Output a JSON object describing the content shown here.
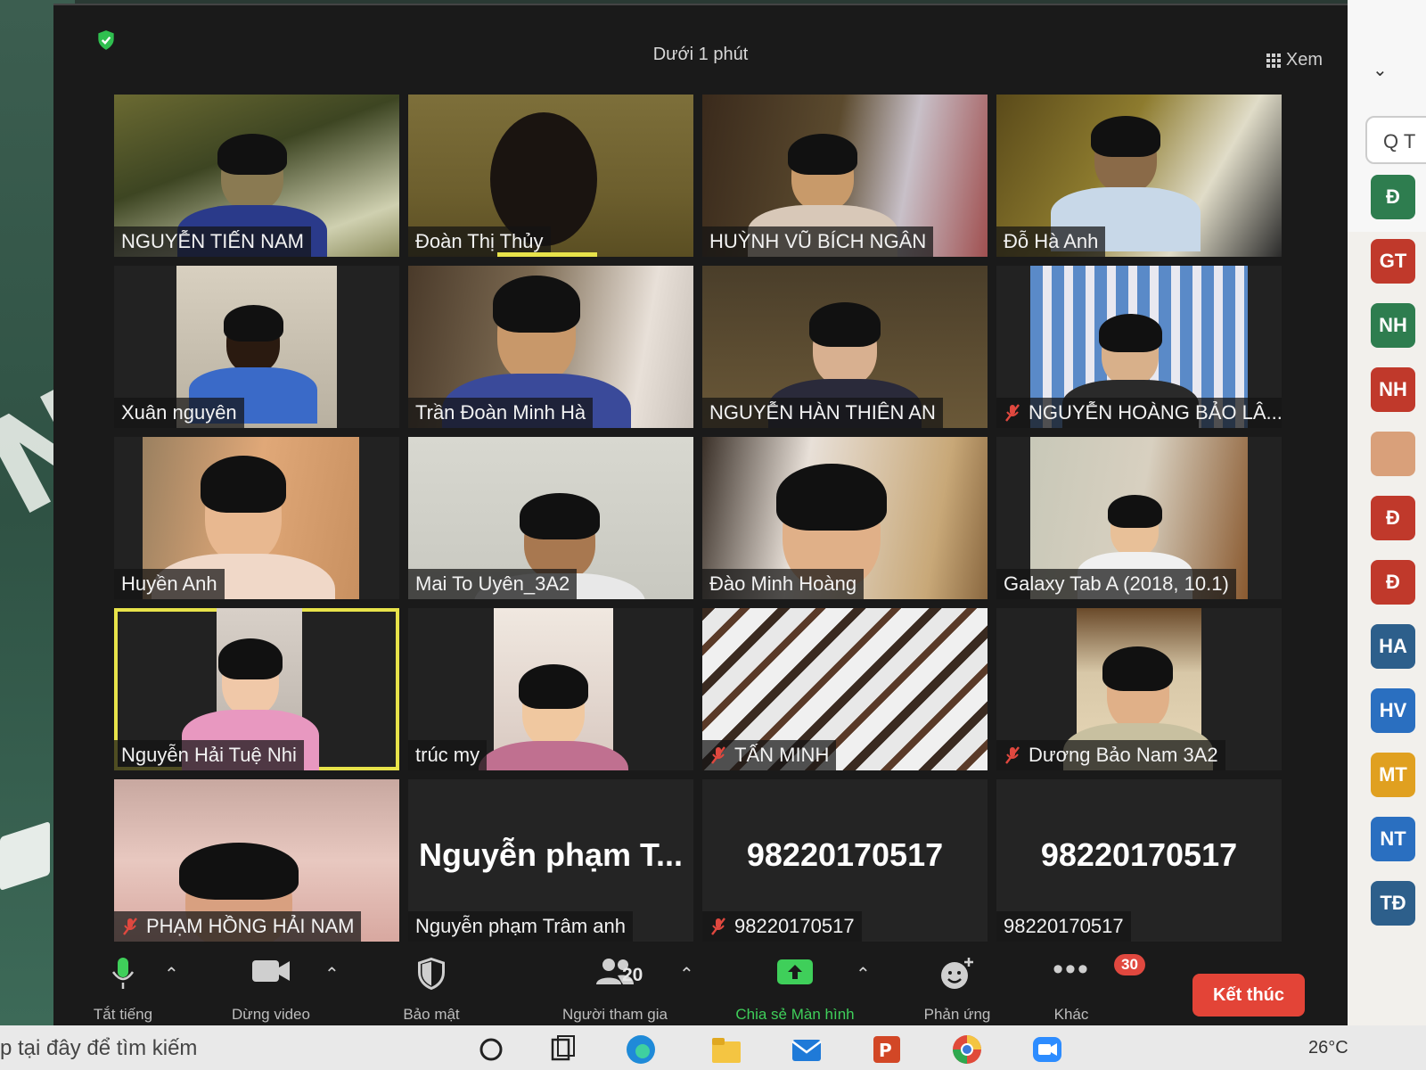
{
  "window": {
    "timer": "Dưới 1 phút",
    "view_label": "Xem"
  },
  "participants": [
    {
      "name": "NGUYỄN TIẾN NAM",
      "muted": false
    },
    {
      "name": "Đoàn Thị Thủy",
      "muted": false,
      "speaking": true
    },
    {
      "name": "HUỲNH VŨ BÍCH NGÂN",
      "muted": false
    },
    {
      "name": "Đỗ Hà Anh",
      "muted": false
    },
    {
      "name": "Xuân nguyên",
      "muted": false
    },
    {
      "name": "Trần Đoàn Minh Hà",
      "muted": false
    },
    {
      "name": "NGUYỄN HÀN THIÊN AN",
      "muted": false
    },
    {
      "name": "NGUYỄN HOÀNG BẢO LÂ...",
      "muted": true
    },
    {
      "name": "Huyền Anh",
      "muted": false
    },
    {
      "name": "Mai To Uyên_3A2",
      "muted": false
    },
    {
      "name": "Đào Minh Hoàng",
      "muted": false
    },
    {
      "name": "Galaxy Tab A (2018, 10.1)",
      "muted": false
    },
    {
      "name": "Nguyễn Hải Tuệ Nhi",
      "muted": false,
      "active": true
    },
    {
      "name": "trúc my",
      "muted": false
    },
    {
      "name": "TẤN MINH",
      "muted": true
    },
    {
      "name": "Dương Bảo Nam 3A2",
      "muted": true
    },
    {
      "name": "PHẠM HỒNG HẢI NAM",
      "muted": true
    },
    {
      "name": "Nguyễn phạm Trâm anh",
      "big_name": "Nguyễn phạm T...",
      "muted": false
    },
    {
      "name": "98220170517",
      "big_name": "98220170517",
      "muted": true
    },
    {
      "name": "98220170517",
      "big_name": "98220170517",
      "muted": false
    }
  ],
  "toolbar": {
    "mute_label": "Tắt tiếng",
    "video_label": "Dừng video",
    "security_label": "Bảo mật",
    "participants_label": "Người tham gia",
    "participants_count": "20",
    "share_label": "Chia sẻ Màn hình",
    "reactions_label": "Phản ứng",
    "more_label": "Khác",
    "more_badge": "30",
    "end_label": "Kết thúc"
  },
  "right_panel": {
    "search_label": "Q T",
    "chips": [
      {
        "label": "Đ",
        "color": "#2e7d4f"
      },
      {
        "label": "GT",
        "color": "#c0392b"
      },
      {
        "label": "NH",
        "color": "#2e7d4f"
      },
      {
        "label": "NH",
        "color": "#c0392b"
      },
      {
        "label": "",
        "color": "#d9a07a"
      },
      {
        "label": "Đ",
        "color": "#c0392b"
      },
      {
        "label": "Đ",
        "color": "#c0392b"
      },
      {
        "label": "HA",
        "color": "#2d5f8b"
      },
      {
        "label": "HV",
        "color": "#2a6fc0"
      },
      {
        "label": "MT",
        "color": "#e0a020"
      },
      {
        "label": "NT",
        "color": "#2a6fc0"
      },
      {
        "label": "TĐ",
        "color": "#2d5f8b"
      }
    ]
  },
  "taskbar": {
    "search_hint": "p tại đây để tìm kiếm",
    "weather": "26°C"
  },
  "colors": {
    "active_border": "#e8e34a",
    "end_button": "#e34437",
    "share_green": "#3fcf5a",
    "mute_red": "#e0483f"
  }
}
